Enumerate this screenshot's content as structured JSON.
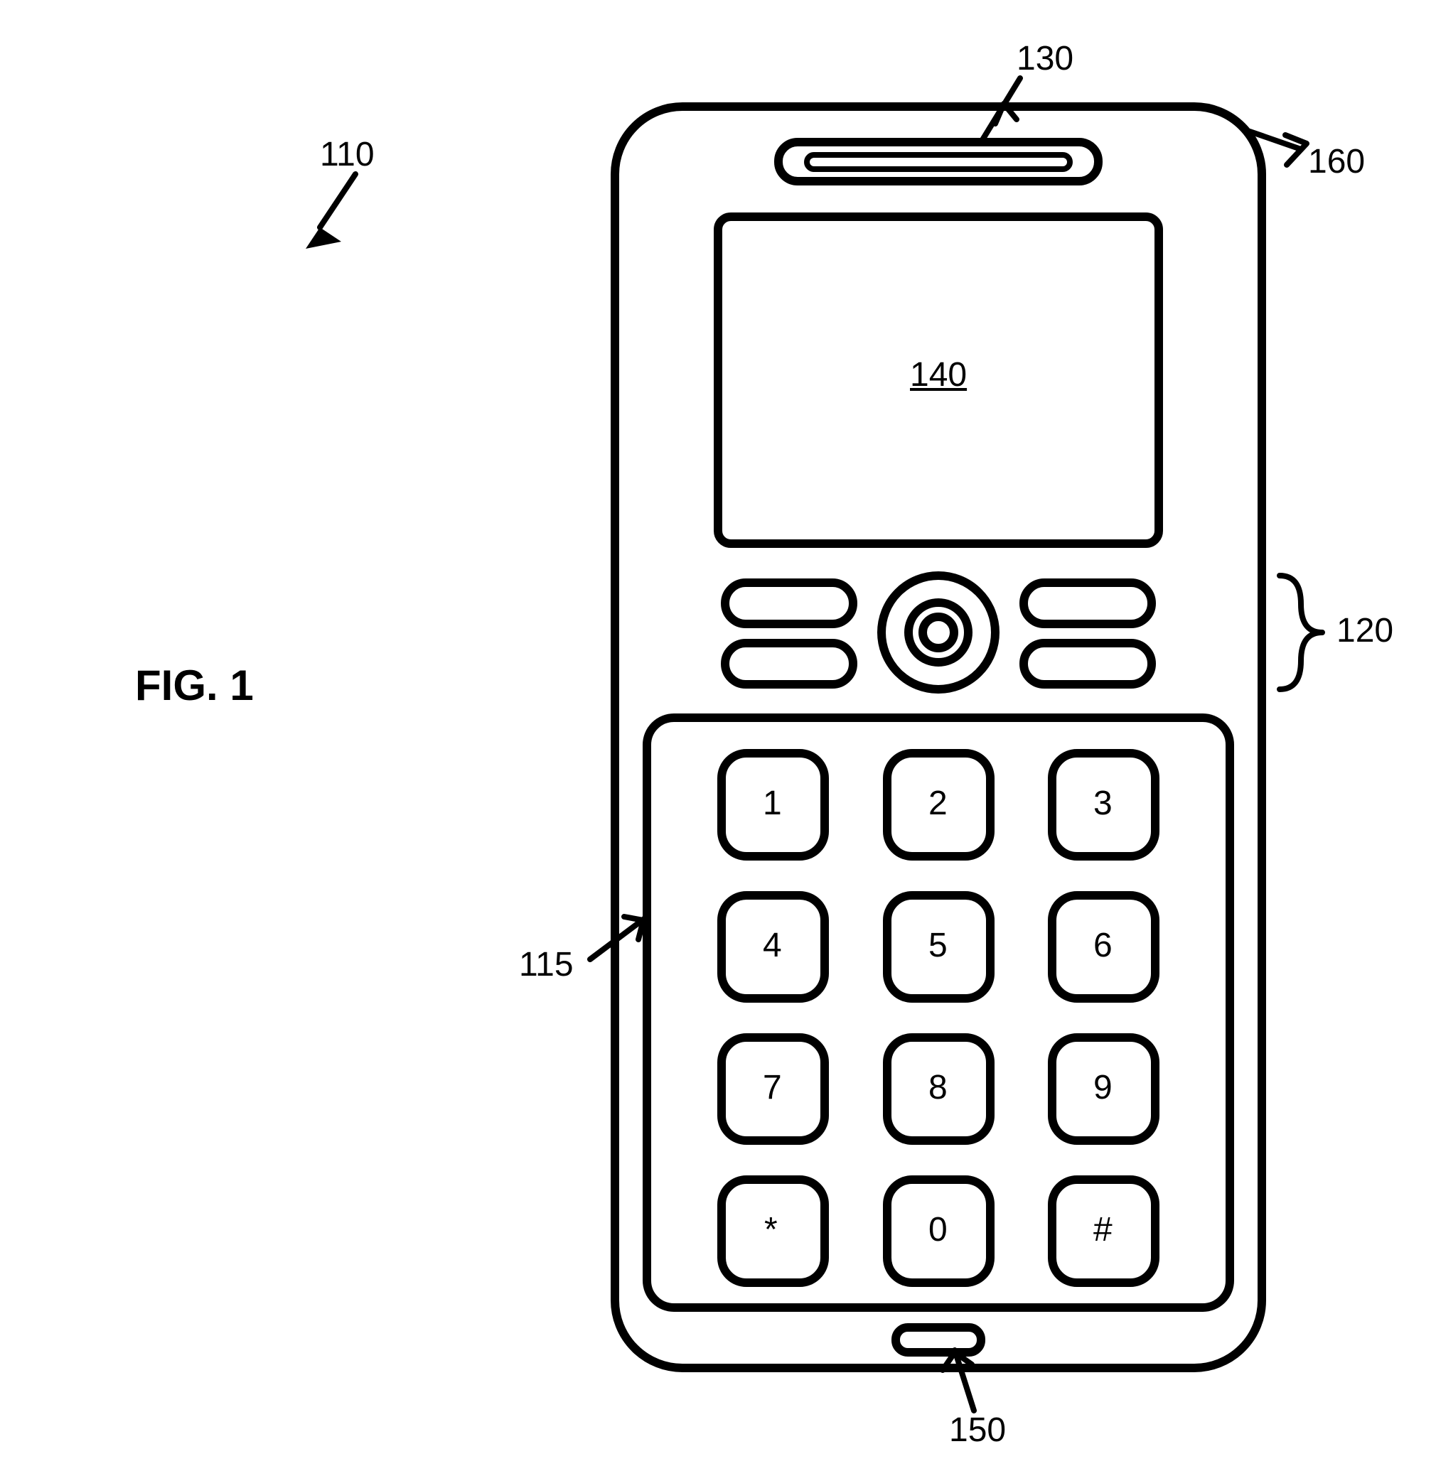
{
  "figure_label": "FIG. 1",
  "callouts": {
    "c110": "110",
    "c115": "115",
    "c120": "120",
    "c130": "130",
    "c140": "140",
    "c150": "150",
    "c160": "160"
  },
  "keypad": {
    "rows": [
      [
        "1",
        "2",
        "3"
      ],
      [
        "4",
        "5",
        "6"
      ],
      [
        "7",
        "8",
        "9"
      ],
      [
        "*",
        "0",
        "#"
      ]
    ]
  }
}
